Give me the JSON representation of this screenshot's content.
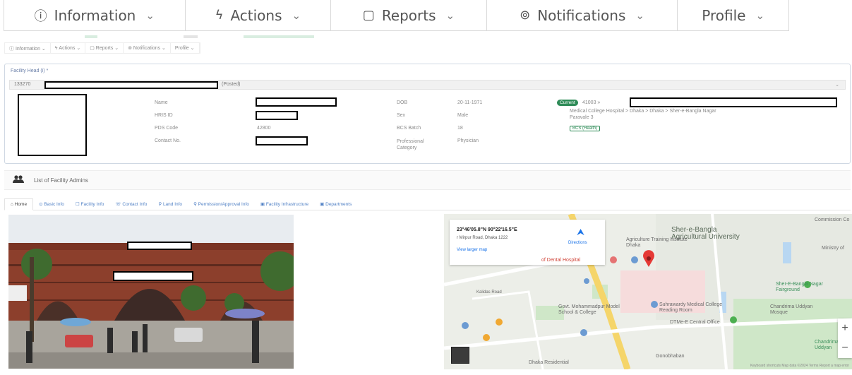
{
  "big_nav": [
    {
      "label": "Information",
      "icon": "info-circle-icon",
      "glyph": "ⓘ"
    },
    {
      "label": "Actions",
      "icon": "lightning-icon",
      "glyph": "ϟ"
    },
    {
      "label": "Reports",
      "icon": "clipboard-icon",
      "glyph": "▢"
    },
    {
      "label": "Notifications",
      "icon": "help-circle-icon",
      "glyph": "⊚"
    },
    {
      "label": "Profile",
      "icon": "",
      "glyph": ""
    }
  ],
  "chevron": "⌄",
  "small_nav": [
    "ⓘ Information ⌄",
    "ϟ Actions ⌄",
    "▢ Reports ⌄",
    "⊚ Notifications ⌄",
    "Profile ⌄"
  ],
  "facility": {
    "label": "Facility Head (i) *",
    "code": "133270",
    "tag": "(Posted)",
    "fields_left": [
      {
        "key": "Name",
        "value": ""
      },
      {
        "key": "HRIS ID",
        "value": ""
      },
      {
        "key": "PDS Code",
        "value": "42800"
      },
      {
        "key": "Contact No.",
        "value": ""
      }
    ],
    "fields_right": [
      {
        "key": "DOB",
        "value": "20-11-1971"
      },
      {
        "key": "Sex",
        "value": "Male"
      },
      {
        "key": "BCS Batch",
        "value": "18"
      },
      {
        "key": "Professional Category",
        "value": "Physician"
      }
    ],
    "status_badge": "Current",
    "status_code": "41003 »",
    "location": "Medical College Hospital > Dhaka > Dhaka > Sher-e-Bangla Nagar",
    "designation": "Paravale 3",
    "chip": "BCS (Health)"
  },
  "admins_title": "List of Facility Admins",
  "tabs": [
    "⌂ Home",
    "⊙ Basic Info",
    "☐ Facility Info",
    "☏ Contact Info",
    "⚲ Land Info",
    "⚲ Permission/Approval Info",
    "▣ Facility Infrastructure",
    "▣ Departments"
  ],
  "map": {
    "coord": "23°46'05.8\"N 90°22'16.5\"E",
    "address": "r Mirpur Road, Dhaka 1222",
    "directions": "Directions",
    "larger": "View larger map",
    "labels": [
      "Sher-e-Bangla Agricultural University",
      "Agriculture Training Institute Dhaka",
      "Ministry of",
      "of Dental Hospital",
      "Sher-E-Bangla Nagar Fairground",
      "Suhrawardy Medical College Reading Room",
      "Chandrima Uddyan Mosque",
      "Govt. Mohammadpur Model School & College",
      "DTMe-E Central Office",
      "Chandrima Uddyan",
      "Dhaka Residential",
      "Gonobhaban",
      "Kalidas Road",
      "Commission Co"
    ],
    "attribution": "Keyboard shortcuts  Map data ©2024  Terms  Report a map error"
  }
}
